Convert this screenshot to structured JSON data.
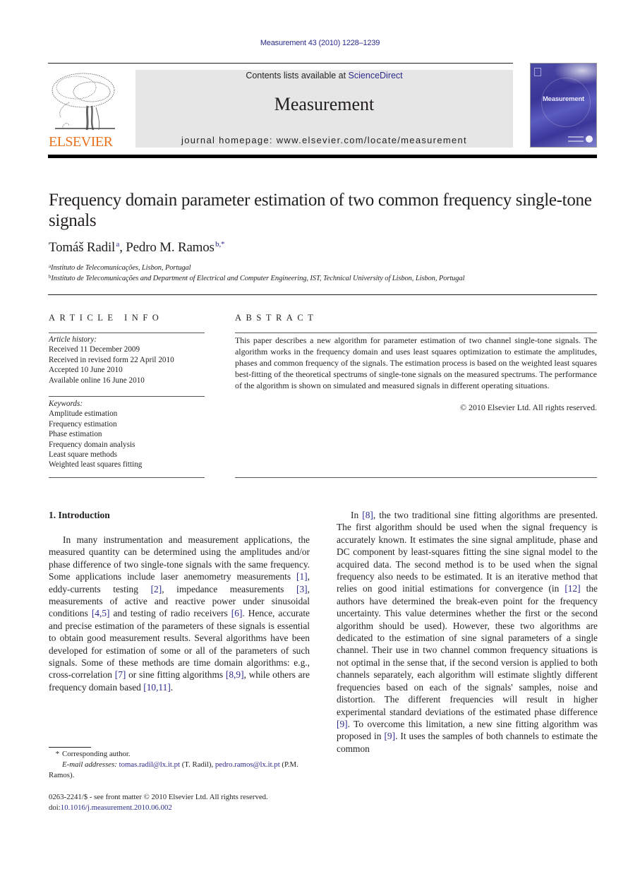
{
  "header": {
    "citation": "Measurement 43 (2010) 1228–1239",
    "contents_prefix": "Contents lists available at ",
    "contents_link": "ScienceDirect",
    "journal_name": "Measurement",
    "homepage": "journal homepage: www.elsevier.com/locate/measurement",
    "publisher_logo_text": "ELSEVIER",
    "cover_title": "Measurement",
    "brand_color": "#e9711c",
    "link_color": "#2b2b8c"
  },
  "article": {
    "title": "Frequency domain parameter estimation of two common frequency single-tone signals",
    "authors": [
      {
        "name": "Tomáš Radil",
        "marks": "a"
      },
      {
        "name": "Pedro M. Ramos",
        "marks": "b,*"
      }
    ],
    "author_separator": ", ",
    "affiliations": [
      {
        "mark": "a",
        "text": "Instituto de Telecomunicações, Lisbon, Portugal"
      },
      {
        "mark": "b",
        "text": "Instituto de Telecomunicações and Department of Electrical and Computer Engineering, IST, Technical University of Lisbon, Lisbon, Portugal"
      }
    ]
  },
  "article_info": {
    "heading": "ARTICLE INFO",
    "history_label": "Article history:",
    "history": [
      "Received 11 December 2009",
      "Received in revised form 22 April 2010",
      "Accepted 10 June 2010",
      "Available online 16 June 2010"
    ],
    "keywords_label": "Keywords:",
    "keywords": [
      "Amplitude estimation",
      "Frequency estimation",
      "Phase estimation",
      "Frequency domain analysis",
      "Least square methods",
      "Weighted least squares fitting"
    ]
  },
  "abstract": {
    "heading": "ABSTRACT",
    "text": "This paper describes a new algorithm for parameter estimation of two channel single-tone signals. The algorithm works in the frequency domain and uses least squares optimization to estimate the amplitudes, phases and common frequency of the signals. The estimation process is based on the weighted least squares best-fitting of the theoretical spectrums of single-tone signals on the measured spectrums. The performance of the algorithm is shown on simulated and measured signals in different operating situations.",
    "copyright": "© 2010 Elsevier Ltd. All rights reserved."
  },
  "introduction": {
    "heading": "1. Introduction",
    "left_column": [
      {
        "t": "In many instrumentation and measurement applications, the measured quantity can be determined using the amplitudes and/or phase difference of two single-tone signals with the same frequency. Some applications include laser anemometry measurements "
      },
      {
        "ref": "[1]"
      },
      {
        "t": ", eddy-currents testing "
      },
      {
        "ref": "[2]"
      },
      {
        "t": ", impedance measurements "
      },
      {
        "ref": "[3]"
      },
      {
        "t": ", measurements of active and reactive power under sinusoidal conditions "
      },
      {
        "ref": "[4,5]"
      },
      {
        "t": " and testing of radio receivers "
      },
      {
        "ref": "[6]"
      },
      {
        "t": ". Hence, accurate and precise estimation of the parameters of these signals is essential to obtain good measurement results. Several algorithms have been developed for estimation of some or all of the parameters of such signals. Some of these methods are time domain algorithms: e.g., cross-correlation "
      },
      {
        "ref": "[7]"
      },
      {
        "t": " or sine fitting algorithms "
      },
      {
        "ref": "[8,9]"
      },
      {
        "t": ", while others are frequency domain based "
      },
      {
        "ref": "[10,11]"
      },
      {
        "t": "."
      }
    ],
    "right_column": [
      {
        "t": "In "
      },
      {
        "ref": "[8]"
      },
      {
        "t": ", the two traditional sine fitting algorithms are presented. The first algorithm should be used when the signal frequency is accurately known. It estimates the sine signal amplitude, phase and DC component by least-squares fitting the sine signal model to the acquired data. The second method is to be used when the signal frequency also needs to be estimated. It is an iterative method that relies on good initial estimations for convergence (in "
      },
      {
        "ref": "[12]"
      },
      {
        "t": " the authors have determined the break-even point for the frequency uncertainty. This value determines whether the first or the second algorithm should be used). However, these two algorithms are dedicated to the estimation of sine signal parameters of a single channel. Their use in two channel common frequency situations is not optimal in the sense that, if the second version is applied to both channels separately, each algorithm will estimate slightly different frequencies based on each of the signals' samples, noise and distortion. The different frequencies will result in higher experimental standard deviations of the estimated phase difference "
      },
      {
        "ref": "[9]"
      },
      {
        "t": ". To overcome this limitation, a new sine fitting algorithm was proposed in "
      },
      {
        "ref": "[9]"
      },
      {
        "t": ". It uses the samples of both channels to estimate the common"
      }
    ]
  },
  "footnotes": {
    "corresponding_mark": "*",
    "corresponding_text": "Corresponding author.",
    "email_label": "E-mail addresses:",
    "emails": [
      {
        "address": "tomas.radil@lx.it.pt",
        "owner": "(T. Radil)"
      },
      {
        "address": "pedro.ramos@lx.it.pt",
        "owner": "(P.M. Ramos)."
      }
    ],
    "front_matter": "0263-2241/$ - see front matter © 2010 Elsevier Ltd. All rights reserved.",
    "doi_prefix": "doi:",
    "doi": "10.1016/j.measurement.2010.06.002"
  }
}
